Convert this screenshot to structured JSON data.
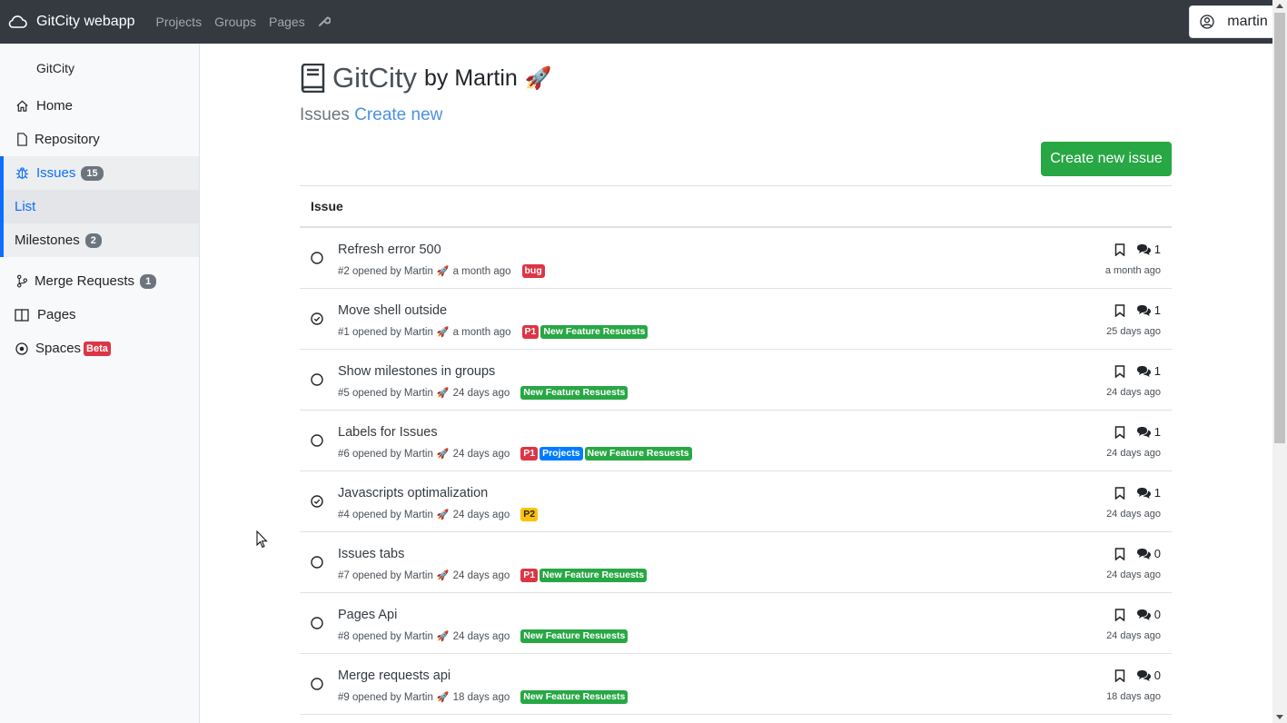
{
  "navbar": {
    "brand": "GitCity webapp",
    "links": [
      "Projects",
      "Groups",
      "Pages"
    ],
    "user": "martin"
  },
  "sidebar": {
    "title": "GitCity",
    "items": [
      {
        "label": "Home",
        "icon": "home-icon"
      },
      {
        "label": "Repository",
        "icon": "file-icon"
      },
      {
        "label": "Issues",
        "icon": "bug-icon",
        "badge": "15"
      },
      {
        "label": "List"
      },
      {
        "label": "Milestones",
        "badge": "2"
      },
      {
        "label": "Merge Requests",
        "icon": "branch-icon",
        "badge": "1"
      },
      {
        "label": "Pages",
        "icon": "book-open-icon"
      },
      {
        "label": "Spaces",
        "icon": "record-icon",
        "badge": "Beta"
      }
    ]
  },
  "main": {
    "repo_name": "GitCity",
    "by_line": "by Martin",
    "rocket": "🚀",
    "subtitle": "Issues",
    "create_link": "Create new",
    "create_button": "Create new issue",
    "table_header": "Issue"
  },
  "colors": {
    "navbar": "#343a40",
    "accent": "#0d6efd",
    "success": "#28a745",
    "danger": "#dc3545",
    "warning": "#ffc107",
    "primary_label": "#007bff"
  },
  "issues": [
    {
      "title": "Refresh error 500",
      "number": "#2",
      "opened_by": "opened by Martin",
      "ago": "a month ago",
      "labels": [
        {
          "text": "bug",
          "color": "#dc3545"
        }
      ],
      "comments": "1",
      "updated": "a month ago",
      "closed": false
    },
    {
      "title": "Move shell outside",
      "number": "#1",
      "opened_by": "opened by Martin",
      "ago": "a month ago",
      "labels": [
        {
          "text": "P1",
          "color": "#dc3545"
        },
        {
          "text": "New Feature Resuests",
          "color": "#28a745"
        }
      ],
      "comments": "1",
      "updated": "25 days ago",
      "closed": true
    },
    {
      "title": "Show milestones in groups",
      "number": "#5",
      "opened_by": "opened by Martin",
      "ago": "24 days ago",
      "labels": [
        {
          "text": "New Feature Resuests",
          "color": "#28a745"
        }
      ],
      "comments": "1",
      "updated": "24 days ago",
      "closed": false
    },
    {
      "title": "Labels for Issues",
      "number": "#6",
      "opened_by": "opened by Martin",
      "ago": "24 days ago",
      "labels": [
        {
          "text": "P1",
          "color": "#dc3545"
        },
        {
          "text": "Projects",
          "color": "#007bff"
        },
        {
          "text": "New Feature Resuests",
          "color": "#28a745"
        }
      ],
      "comments": "1",
      "updated": "24 days ago",
      "closed": false
    },
    {
      "title": "Javascripts optimalization",
      "number": "#4",
      "opened_by": "opened by Martin",
      "ago": "24 days ago",
      "labels": [
        {
          "text": "P2",
          "color": "#ffc107"
        }
      ],
      "comments": "1",
      "updated": "24 days ago",
      "closed": true
    },
    {
      "title": "Issues tabs",
      "number": "#7",
      "opened_by": "opened by Martin",
      "ago": "24 days ago",
      "labels": [
        {
          "text": "P1",
          "color": "#dc3545"
        },
        {
          "text": "New Feature Resuests",
          "color": "#28a745"
        }
      ],
      "comments": "0",
      "updated": "24 days ago",
      "closed": false
    },
    {
      "title": "Pages Api",
      "number": "#8",
      "opened_by": "opened by Martin",
      "ago": "24 days ago",
      "labels": [
        {
          "text": "New Feature Resuests",
          "color": "#28a745"
        }
      ],
      "comments": "0",
      "updated": "24 days ago",
      "closed": false
    },
    {
      "title": "Merge requests api",
      "number": "#9",
      "opened_by": "opened by Martin",
      "ago": "18 days ago",
      "labels": [
        {
          "text": "New Feature Resuests",
          "color": "#28a745"
        }
      ],
      "comments": "0",
      "updated": "18 days ago",
      "closed": false
    }
  ]
}
